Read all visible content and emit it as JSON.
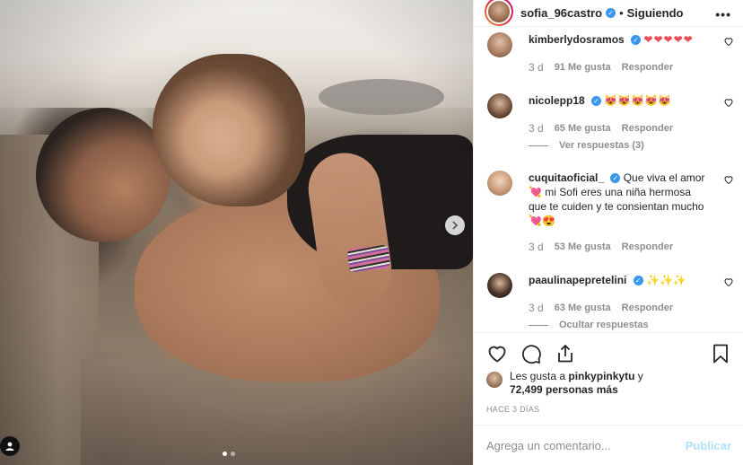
{
  "post": {
    "username": "sofia_96castro",
    "separator": "•",
    "follow_status": "Siguiendo",
    "more_label": "•••"
  },
  "comments": [
    {
      "user": "kimberlydosramos",
      "text": "❤❤❤❤❤",
      "time": "3 d",
      "likes": "91 Me gusta",
      "reply": "Responder",
      "verified": true
    },
    {
      "user": "nicolepp18",
      "text": "😻😻😻😻😻",
      "time": "3 d",
      "likes": "65 Me gusta",
      "reply": "Responder",
      "verified": true,
      "replies": "Ver respuestas (3)"
    },
    {
      "user": "cuquitaoficial_",
      "text": "Que viva el amor 💘 mi Sofi eres una niña hermosa que te cuiden y te consientan mucho 💘😍",
      "time": "3 d",
      "likes": "53 Me gusta",
      "reply": "Responder",
      "verified": true
    },
    {
      "user": "paaulinapepretelini",
      "text": "✨✨✨",
      "time": "3 d",
      "likes": "63 Me gusta",
      "reply": "Responder",
      "verified": true,
      "replies": "Ocultar respuestas"
    }
  ],
  "likes": {
    "prefix": "Les gusta a ",
    "user": "pinkypinkytu",
    "suffix": " y",
    "count": "72,499 personas más"
  },
  "time_ago": "HACE 3 DÍAS",
  "add_comment": {
    "placeholder": "Agrega un comentario...",
    "publish": "Publicar"
  },
  "carousel": {
    "current": 1,
    "total": 2
  },
  "colors": {
    "accent": "#3897f0",
    "publish_disabled": "#b2dffc",
    "heart": "#ed4956",
    "muted": "#8e8e8e"
  },
  "icons": [
    "heart-icon",
    "comment-icon",
    "share-icon",
    "bookmark-icon",
    "next-arrow-icon",
    "user-tag-icon",
    "verified-icon",
    "more-options-icon"
  ]
}
